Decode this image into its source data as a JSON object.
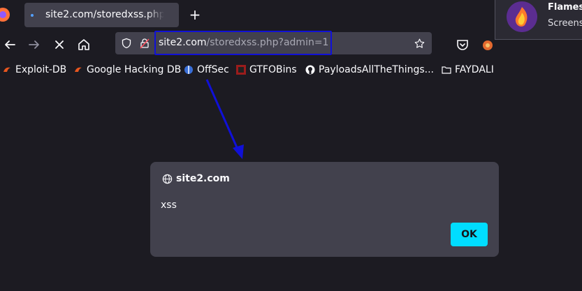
{
  "tab": {
    "title": "site2.com/storedxss.php?"
  },
  "url": {
    "host": "site2.com",
    "path": "/storedxss.php?admin=1"
  },
  "notification": {
    "title": "Flamesh",
    "subtitle": "Screens"
  },
  "bookmarks": [
    {
      "label": "Exploit-DB",
      "icon": "exploit-db-icon"
    },
    {
      "label": "Google Hacking DB",
      "icon": "ghdb-icon"
    },
    {
      "label": "OffSec",
      "icon": "offsec-icon"
    },
    {
      "label": "GTFOBins",
      "icon": "gtfobins-icon"
    },
    {
      "label": "PayloadsAllTheThings...",
      "icon": "github-icon"
    },
    {
      "label": "FAYDALI",
      "icon": "folder-icon"
    }
  ],
  "dialog": {
    "origin": "site2.com",
    "message": "xss",
    "ok_label": "OK"
  },
  "colors": {
    "accent": "#00ddff",
    "annotation": "#1010d8",
    "background": "#1c1b22"
  }
}
